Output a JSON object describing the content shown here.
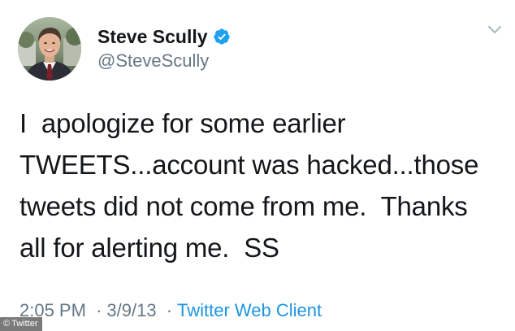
{
  "author": {
    "display_name": "Steve Scully",
    "handle": "@SteveScully",
    "verified_icon": "verified-badge-icon",
    "avatar_icon": "profile-avatar"
  },
  "tweet": {
    "text": "I  apologize for some earlier\nTWEETS...account was hacked...those\ntweets did not come from me.  Thanks\nall for alerting me.  SS"
  },
  "meta": {
    "time": "2:05 PM",
    "separator": "·",
    "date": "3/9/13",
    "client": "Twitter Web Client"
  },
  "menu": {
    "icon": "chevron-down-icon"
  },
  "watermark": {
    "symbol": "©",
    "label": "Twitter"
  },
  "colors": {
    "text": "#14171a",
    "secondary": "#657786",
    "link": "#1b95e0",
    "verified": "#1da1f2"
  }
}
